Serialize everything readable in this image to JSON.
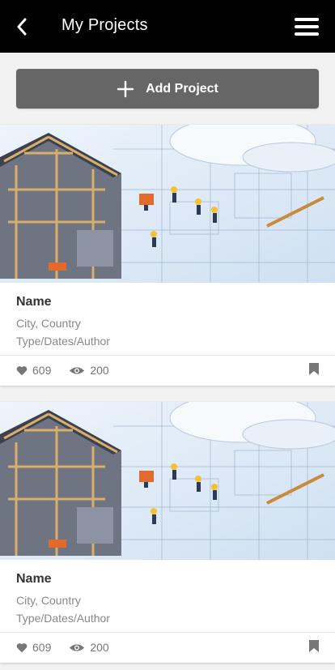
{
  "header": {
    "title": "My Projects",
    "back_icon": "chevron-left-icon",
    "menu_icon": "hamburger-menu-icon"
  },
  "add_project": {
    "label": "Add Project",
    "icon": "plus-icon"
  },
  "projects": [
    {
      "name": "Name",
      "location": "City, Country",
      "meta": "Type/Dates/Author",
      "likes": "609",
      "views": "200"
    },
    {
      "name": "Name",
      "location": "City, Country",
      "meta": "Type/Dates/Author",
      "likes": "609",
      "views": "200"
    }
  ],
  "colors": {
    "appbar": "#000000",
    "button": "#666666",
    "background": "#f2f2f2",
    "muted_text": "#888888"
  }
}
